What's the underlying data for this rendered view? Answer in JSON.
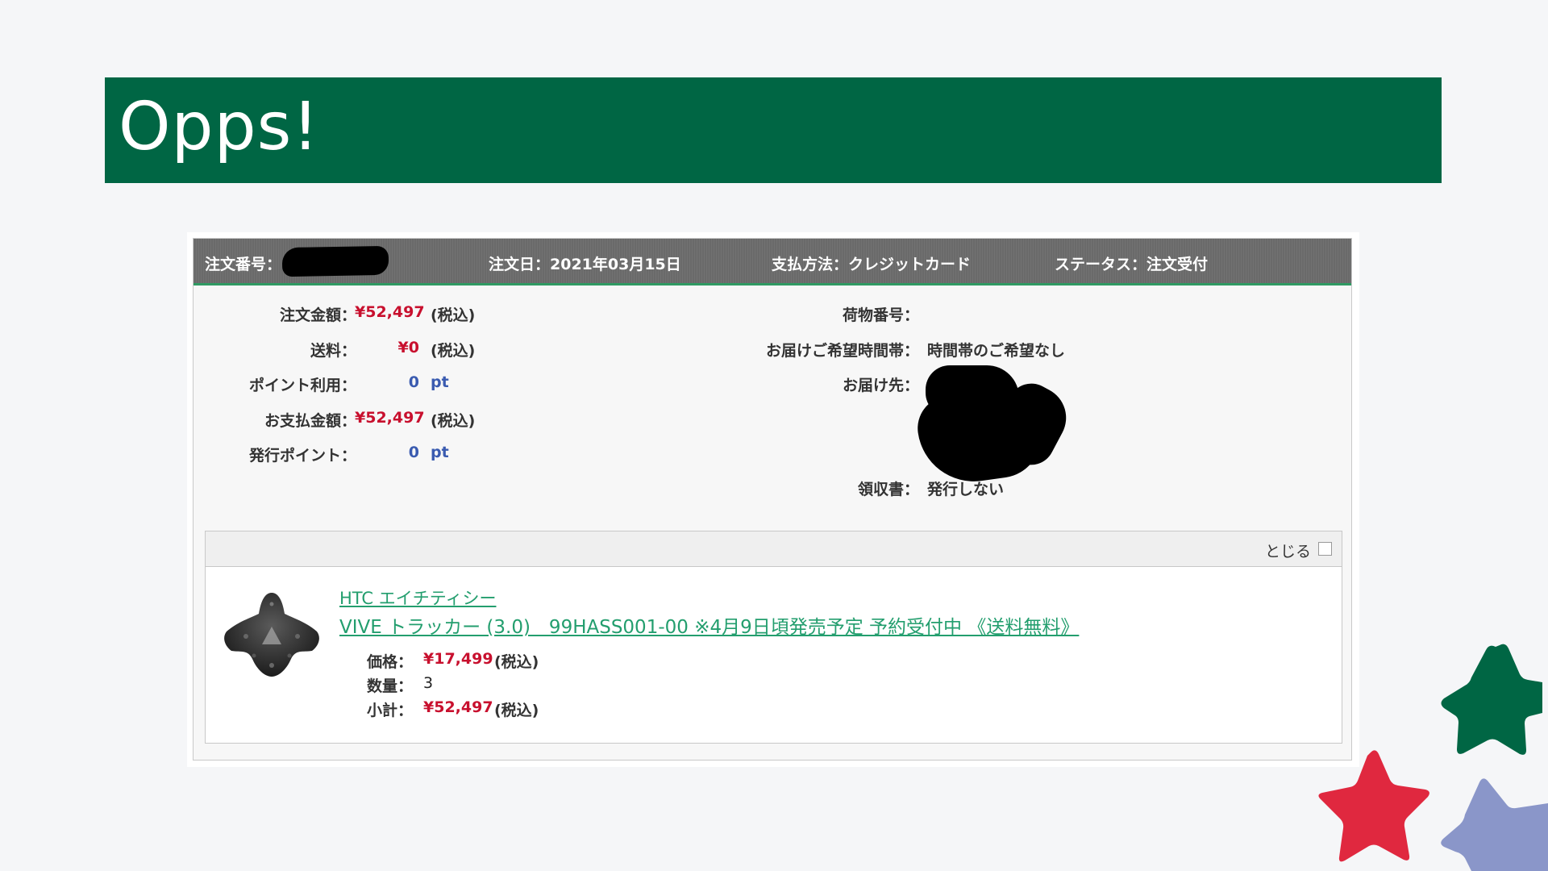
{
  "slide": {
    "title": "Opps!"
  },
  "order": {
    "number_label": "注文番号：",
    "date": "注文日：2021年03月15日",
    "payment": "支払方法：クレジットカード",
    "status": "ステータス：注文受付"
  },
  "summary": {
    "rows": [
      {
        "label": "注文金額：",
        "value": "¥52,497",
        "unit": "(税込)"
      },
      {
        "label": "送料：",
        "value": "¥0",
        "unit": "(税込)"
      },
      {
        "label": "ポイント利用：",
        "value": "0",
        "unit": "pt"
      },
      {
        "label": "お支払金額：",
        "value": "¥52,497",
        "unit": "(税込)"
      },
      {
        "label": "発行ポイント：",
        "value": "0",
        "unit": "pt"
      }
    ]
  },
  "delivery": {
    "tracking_label": "荷物番号：",
    "time_label": "お届けご希望時間帯：",
    "time_value": "時間帯のご希望なし",
    "address_label": "お届け先：",
    "receipt_label": "領収書：",
    "receipt_value": "発行しない"
  },
  "items_panel": {
    "close_label": "とじる"
  },
  "item": {
    "brand": "HTC エイチティシー",
    "name": "VIVE トラッカー (3.0)　99HASS001-00 ※4月9日頃発売予定 予約受付中 《送料無料》",
    "price_label": "価格：",
    "price": "¥17,499",
    "price_unit": "(税込)",
    "qty_label": "数量：",
    "qty": "3",
    "subtotal_label": "小計：",
    "subtotal": "¥52,497",
    "subtotal_unit": "(税込)"
  },
  "colors": {
    "title_bar": "#006644",
    "price_red": "#c8102e",
    "point_blue": "#3a5bb0",
    "link_green": "#239e6e",
    "star_green": "#006644",
    "star_red": "#e0283f",
    "star_blue": "#8a96c9"
  }
}
